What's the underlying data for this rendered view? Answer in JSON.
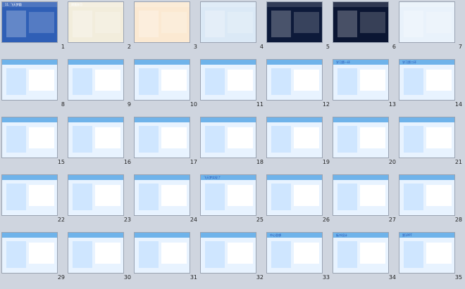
{
  "slides": [
    {
      "n": "1",
      "title": "11. 飞天梦圆"
    },
    {
      "n": "2",
      "title": "嫦娥奔月"
    },
    {
      "n": "3",
      "title": ""
    },
    {
      "n": "4",
      "title": ""
    },
    {
      "n": "5",
      "title": ""
    },
    {
      "n": "6",
      "title": ""
    },
    {
      "n": "7",
      "title": ""
    },
    {
      "n": "8",
      "title": ""
    },
    {
      "n": "9",
      "title": ""
    },
    {
      "n": "10",
      "title": ""
    },
    {
      "n": "11",
      "title": ""
    },
    {
      "n": "12",
      "title": ""
    },
    {
      "n": "13",
      "title": "学习第一环"
    },
    {
      "n": "14",
      "title": "学习第二环"
    },
    {
      "n": "15",
      "title": ""
    },
    {
      "n": "16",
      "title": ""
    },
    {
      "n": "17",
      "title": ""
    },
    {
      "n": "18",
      "title": ""
    },
    {
      "n": "19",
      "title": ""
    },
    {
      "n": "20",
      "title": ""
    },
    {
      "n": "21",
      "title": ""
    },
    {
      "n": "22",
      "title": ""
    },
    {
      "n": "23",
      "title": ""
    },
    {
      "n": "24",
      "title": ""
    },
    {
      "n": "25",
      "title": "飞天梦实现了"
    },
    {
      "n": "26",
      "title": ""
    },
    {
      "n": "27",
      "title": ""
    },
    {
      "n": "28",
      "title": ""
    },
    {
      "n": "29",
      "title": ""
    },
    {
      "n": "30",
      "title": ""
    },
    {
      "n": "31",
      "title": ""
    },
    {
      "n": "32",
      "title": ""
    },
    {
      "n": "33",
      "title": "中心思想"
    },
    {
      "n": "34",
      "title": "板书设计"
    },
    {
      "n": "35",
      "title": "第1PPT"
    }
  ],
  "colors": {
    "blue": "#1f4fb4",
    "sky": "#6fb3ea",
    "dark": "#223",
    "green": "#3c9a3c",
    "red": "#d02222",
    "orange": "#f08a1a"
  }
}
